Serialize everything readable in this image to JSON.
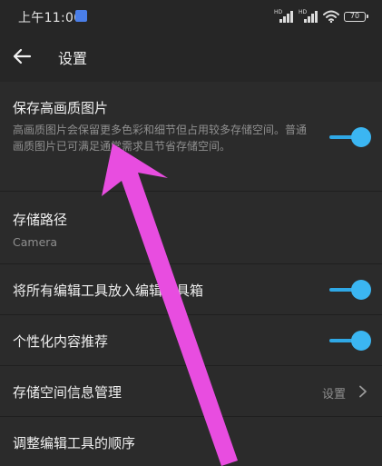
{
  "status_bar": {
    "time": "上午11:00",
    "signal_label": "HD",
    "battery": "70"
  },
  "header": {
    "title": "设置"
  },
  "settings": {
    "hq_photo": {
      "title": "保存高画质图片",
      "description": "高画质图片会保留更多色彩和细节但占用较多存储空间。普通画质图片已可满足通常需求且节省存储空间。",
      "enabled": true
    },
    "storage_path": {
      "title": "存储路径",
      "value": "Camera"
    },
    "toolbox": {
      "title": "将所有编辑工具放入编辑工具箱",
      "enabled": true
    },
    "personalized": {
      "title": "个性化内容推荐",
      "enabled": true
    },
    "storage_info": {
      "title": "存储空间信息管理",
      "action_label": "设置"
    },
    "tool_order": {
      "title": "调整编辑工具的顺序"
    }
  },
  "colors": {
    "accent": "#3bb6f2",
    "annotation_arrow": "#e84de0",
    "background": "#2b2b2b"
  }
}
